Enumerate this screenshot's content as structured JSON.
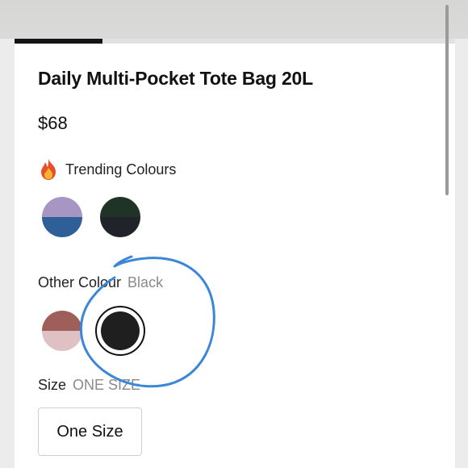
{
  "product": {
    "title": "Daily Multi-Pocket Tote Bag 20L",
    "price": "$68"
  },
  "gallery": {
    "progress_fraction": 0.2
  },
  "trending": {
    "icon": "fire-icon",
    "label": "Trending Colours",
    "swatches": [
      {
        "top": "#a795c4",
        "bottom": "#2e5f97"
      },
      {
        "top": "#1f3326",
        "bottom": "#20232a"
      }
    ]
  },
  "other": {
    "label": "Other Colour",
    "selected_value": "Black",
    "swatches": [
      {
        "top": "#9e5f5b",
        "bottom": "#dfc1c4"
      },
      {
        "color": "#1f1f1f",
        "selected": true
      }
    ]
  },
  "size": {
    "label": "Size",
    "selected_value": "ONE SIZE",
    "options": [
      "One Size"
    ]
  },
  "annotation": {
    "color": "#3a86d8"
  }
}
